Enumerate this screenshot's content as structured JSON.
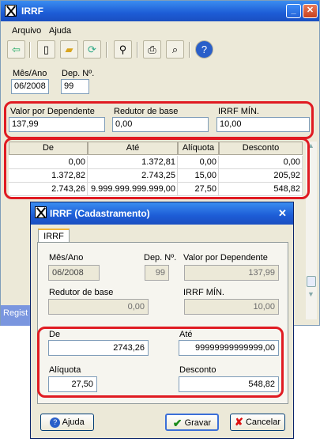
{
  "main": {
    "title": "IRRF",
    "menu": [
      "Arquivo",
      "Ajuda"
    ],
    "toolbar_icons": [
      "exit-icon",
      "new-document-icon",
      "open-folder-icon",
      "refresh-icon",
      "search-icon",
      "print-icon",
      "print-preview-icon",
      "help-icon"
    ],
    "mes_ano_label": "Mês/Ano",
    "mes_ano_value": "06/2008",
    "dep_label": "Dep. Nº.",
    "dep_value": "99",
    "valor_dep_label": "Valor por Dependente",
    "valor_dep_value": "137,99",
    "redutor_label": "Redutor de base",
    "redutor_value": "0,00",
    "irrf_min_label": "IRRF MÍN.",
    "irrf_min_value": "10,00",
    "grid": {
      "headers": [
        "De",
        "Até",
        "Alíquota",
        "Desconto"
      ],
      "rows": [
        [
          "0,00",
          "1.372,81",
          "0,00",
          "0,00"
        ],
        [
          "1.372,82",
          "2.743,25",
          "15,00",
          "205,92"
        ],
        [
          "2.743,26",
          "9.999.999.999.999,00",
          "27,50",
          "548,82"
        ]
      ]
    },
    "status_text": "Regist"
  },
  "dialog": {
    "title": "IRRF (Cadastramento)",
    "tab": "IRRF",
    "mes_ano_label": "Mês/Ano",
    "mes_ano_value": "06/2008",
    "dep_label": "Dep. Nº.",
    "dep_value": "99",
    "valor_dep_label": "Valor por Dependente",
    "valor_dep_value": "137,99",
    "redutor_label": "Redutor de base",
    "redutor_value": "0,00",
    "irrf_min_label": "IRRF MÍN.",
    "irrf_min_value": "10,00",
    "de_label": "De",
    "de_value": "2743,26",
    "ate_label": "Até",
    "ate_value": "99999999999999,00",
    "aliquota_label": "Alíquota",
    "aliquota_value": "27,50",
    "desconto_label": "Desconto",
    "desconto_value": "548,82",
    "btn_ajuda": "Ajuda",
    "btn_gravar": "Gravar",
    "btn_cancelar": "Cancelar"
  },
  "colors": {
    "highlight": "#e01b22",
    "title_blue": "#1d5cd6"
  }
}
